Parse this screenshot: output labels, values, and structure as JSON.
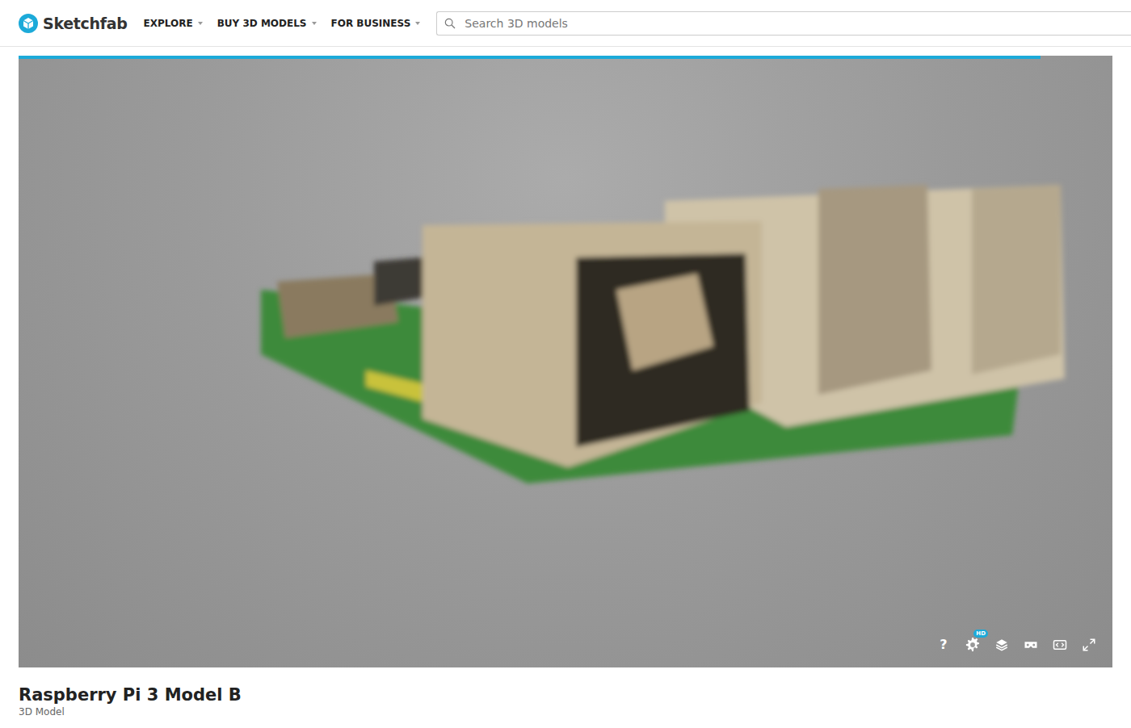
{
  "header": {
    "logo": "Sketchfab",
    "nav": [
      {
        "label": "EXPLORE"
      },
      {
        "label": "BUY 3D MODELS"
      },
      {
        "label": "FOR BUSINESS"
      }
    ],
    "search": {
      "placeholder": "Search 3D models"
    }
  },
  "viewer": {
    "loading": {
      "level": 0.934
    },
    "controls": {
      "help": "?",
      "settings_badge": "HD"
    }
  },
  "model": {
    "title": "Raspberry Pi 3 Model B",
    "subtitle": "3D Model"
  }
}
